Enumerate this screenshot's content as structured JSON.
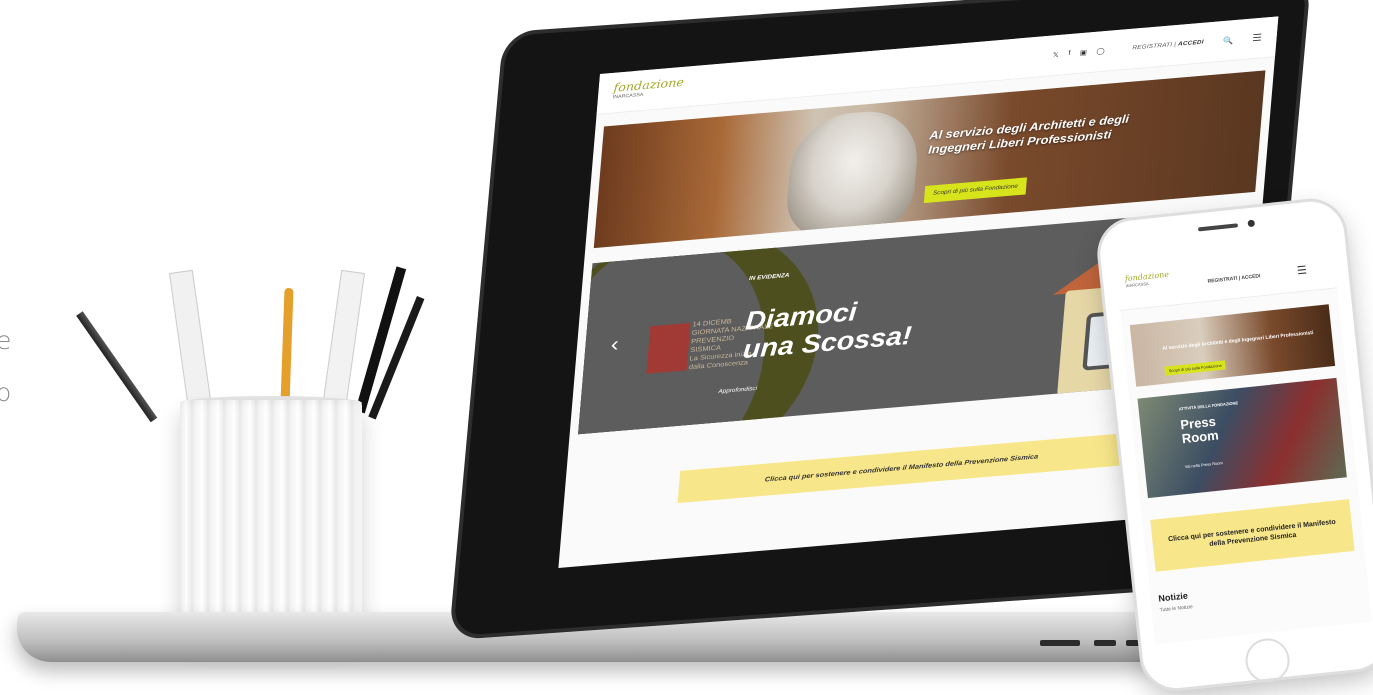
{
  "side_text": [
    "e",
    "o"
  ],
  "site": {
    "logo": {
      "main": "fondazione",
      "sub": "INARCASSA"
    },
    "social": [
      "twitter-icon",
      "facebook-icon",
      "linkedin-icon",
      "instagram-icon"
    ],
    "auth": {
      "register": "REGISTRATI",
      "separator": "|",
      "login": "ACCEDI"
    }
  },
  "hero": {
    "title": "Al servizio degli Architetti e degli Ingegneri Liberi Professionisti",
    "button": "Scopri di più sulla Fondazione"
  },
  "evidenza": {
    "label": "IN EVIDENZA",
    "title_line1": "Diamoci",
    "title_line2": "una Scossa!",
    "link": "Approfondisci",
    "logo_lines": [
      "14 DICEMB",
      "GIORNATA NAZIONALE",
      "PREVENZIO",
      "SISMICA",
      "La Sicurezza inizia",
      "dalla Conoscenza"
    ]
  },
  "manifesto": "Clicca qui per sostenere e condividere il Manifesto della Prevenzione Sismica",
  "phone": {
    "logo": {
      "main": "fondazione",
      "sub": "INARCASSA"
    },
    "auth": "REGISTRATI | ACCEDI",
    "hero": {
      "title": "Al servizio degli Architetti e degli Ingegneri Liberi Professionisti",
      "button": "Scopri di più sulla Fondazione"
    },
    "press": {
      "label": "ATTIVITÀ DELLA FONDAZIONE",
      "title_line1": "Press",
      "title_line2": "Room",
      "link": "Vai nella Press Room"
    },
    "manifesto": "Clicca qui per sostenere e condividere il Manifesto della Prevenzione Sismica",
    "news_title": "Notizie",
    "news_link": "Tutte le Notizie"
  }
}
